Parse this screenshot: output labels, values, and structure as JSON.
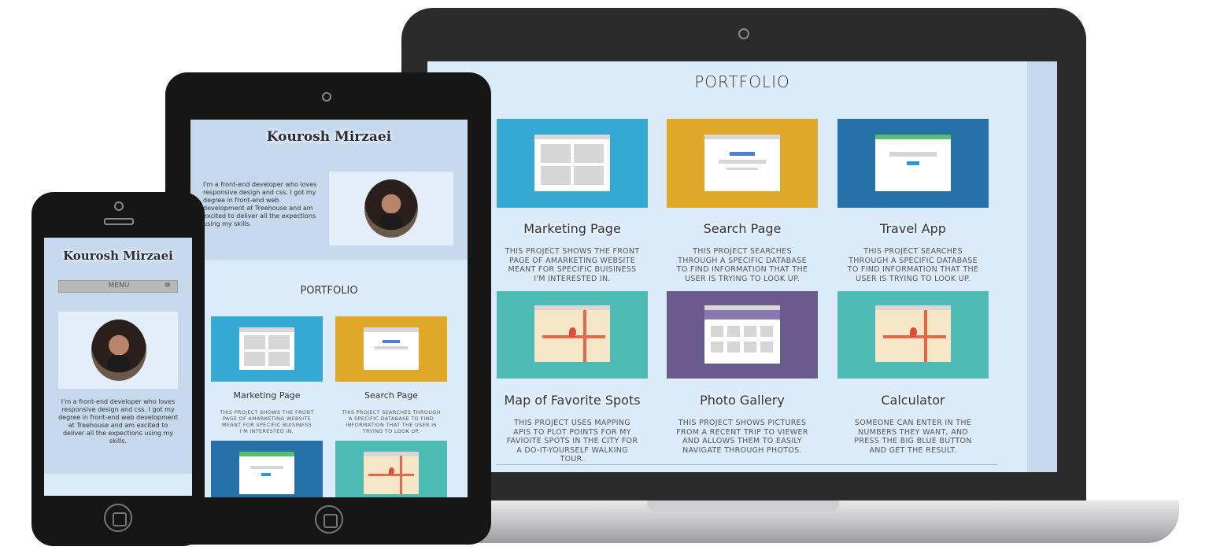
{
  "laptop": {
    "portfolio_title": "PORTFOLIO",
    "projects": [
      {
        "title": "Marketing Page",
        "desc": "This project shows the front page of amarketing website meant for specific buisiness I'm interested in.",
        "color": "#35a9d1"
      },
      {
        "title": "Search Page",
        "desc": "This project searches through a specific database to find information that the user is trying to look up.",
        "color": "#e0a828"
      },
      {
        "title": "Travel App",
        "desc": "This project searches through a specific database to find information that the user is trying to look up.",
        "color": "#2670a8"
      },
      {
        "title": "Map of Favorite Spots",
        "desc": "This project uses mapping APIs to plot points for my favioite spots in the city for a do-it-yourself walking tour.",
        "color": "#4ebab4"
      },
      {
        "title": "Photo Gallery",
        "desc": "This project shows pictures from a recent trip to viewer and allows them to easily navigate through photos.",
        "color": "#6a5a8e"
      },
      {
        "title": "Calculator",
        "desc": "Someone can enter in the numbers they want, and press the big blue button and get the result.",
        "color": "#4ebab4"
      }
    ]
  },
  "tablet": {
    "name": "Kourosh Mirzaei",
    "bio": "I'm a front-end developer who loves responsive design and css. I got my degree in front-end web development at Treehouse and am excited to deliver all the expections using my skills.",
    "portfolio_title": "PORTFOLIO",
    "projects": [
      {
        "title": "Marketing Page",
        "desc": "This project shows the front page of amarketing website meant for specific buisiness I'm interested in."
      },
      {
        "title": "Search Page",
        "desc": "This project searches through a specific database to find information that the user is trying to look up."
      }
    ]
  },
  "phone": {
    "name": "Kourosh Mirzaei",
    "menu_label": "MENU",
    "menu_icon": "hamburger-icon",
    "bio": "I'm a front-end developer who loves responsive design and css. I got my degree in front-end web development at Treehouse and am excited to deliver all the expections using my skills."
  }
}
